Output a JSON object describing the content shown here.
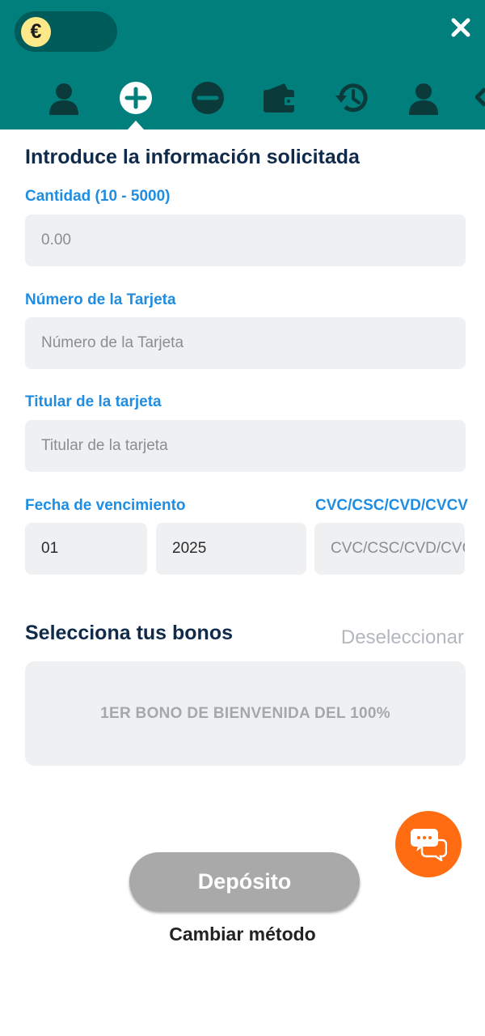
{
  "header": {
    "currency_symbol": "€",
    "nav_icons": [
      "user-icon",
      "plus-circle-icon",
      "minus-circle-icon",
      "wallet-icon",
      "history-icon",
      "user-icon",
      "more-icon"
    ],
    "active_nav": "plus-circle-icon",
    "colors": {
      "header_bg": "#017f7c",
      "toggle_bg": "#005b5b",
      "icon": "#0a3a39"
    }
  },
  "form": {
    "title": "Introduce la información solicitada",
    "amount": {
      "label": "Cantidad (10 - 5000)",
      "placeholder": "0.00"
    },
    "card_number": {
      "label": "Número de la Tarjeta",
      "placeholder": "Número de la Tarjeta"
    },
    "card_holder": {
      "label": "Titular de la tarjeta",
      "placeholder": "Titular de la tarjeta"
    },
    "expiry": {
      "label": "Fecha de vencimiento",
      "month": "01",
      "year": "2025"
    },
    "cvc": {
      "label": "CVC/CSC/CVD/CVCV",
      "placeholder": "CVC/CSC/CVD/CVCV"
    }
  },
  "bonus": {
    "title": "Selecciona tus bonos",
    "deselect_label": "Deseleccionar",
    "items": [
      {
        "label": "1ER BONO DE BIENVENIDA DEL 100%"
      }
    ]
  },
  "actions": {
    "deposit_label": "Depósito",
    "change_method_label": "Cambiar método"
  },
  "chat": {
    "icon": "chat-bubbles-icon",
    "color": "#ff6c11"
  }
}
